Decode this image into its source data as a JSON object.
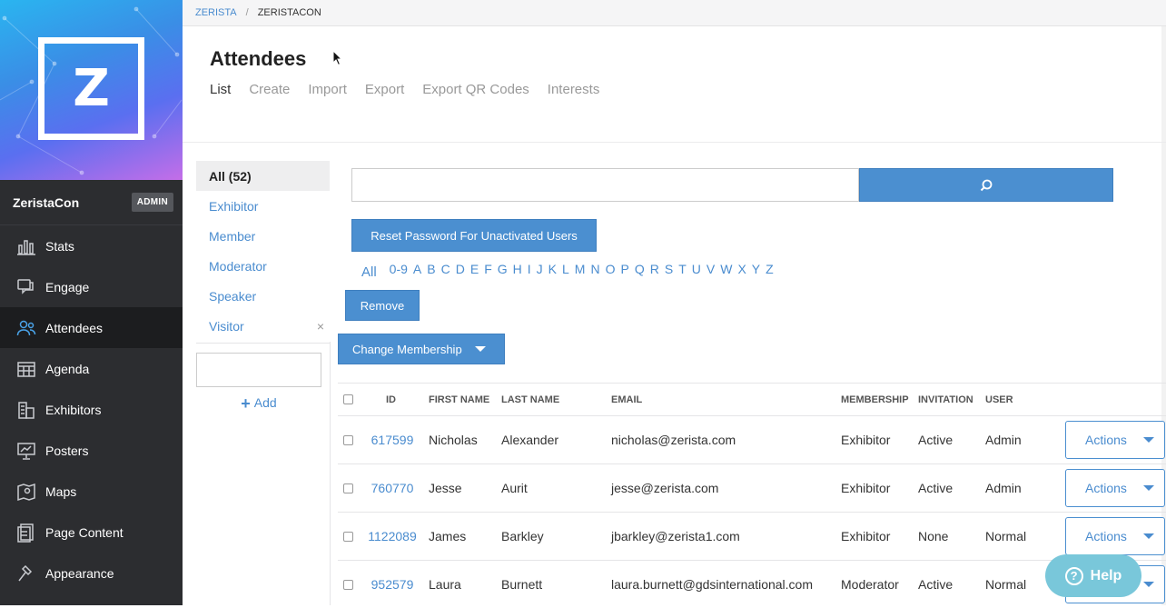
{
  "breadcrumb": {
    "root": "ZERISTA",
    "separator": "/",
    "current": "ZERISTACON"
  },
  "sidebar": {
    "logo_letter": "Z",
    "app_name": "ZeristaCon",
    "badge": "ADMIN",
    "items": [
      {
        "label": "Stats",
        "icon": "stats-icon"
      },
      {
        "label": "Engage",
        "icon": "chat-icon"
      },
      {
        "label": "Attendees",
        "icon": "people-icon",
        "active": true
      },
      {
        "label": "Agenda",
        "icon": "calendar-icon"
      },
      {
        "label": "Exhibitors",
        "icon": "building-icon"
      },
      {
        "label": "Posters",
        "icon": "presentation-icon"
      },
      {
        "label": "Maps",
        "icon": "map-icon"
      },
      {
        "label": "Page Content",
        "icon": "pages-icon"
      },
      {
        "label": "Appearance",
        "icon": "hammer-icon"
      }
    ]
  },
  "header": {
    "title": "Attendees",
    "tabs": [
      "List",
      "Create",
      "Import",
      "Export",
      "Export QR Codes",
      "Interests"
    ]
  },
  "filters": {
    "items": [
      "All (52)",
      "Exhibitor",
      "Member",
      "Moderator",
      "Speaker",
      "Visitor"
    ],
    "remove_symbol": "×",
    "add_label": "Add",
    "add_symbol": "+"
  },
  "search": {
    "placeholder": "",
    "value": ""
  },
  "actions": {
    "reset_label": "Reset Password For Unactivated Users",
    "remove_label": "Remove",
    "change_label": "Change Membership"
  },
  "alphabet": {
    "all": "All",
    "letters": [
      "0-9",
      "A",
      "B",
      "C",
      "D",
      "E",
      "F",
      "G",
      "H",
      "I",
      "J",
      "K",
      "L",
      "M",
      "N",
      "O",
      "P",
      "Q",
      "R",
      "S",
      "T",
      "U",
      "V",
      "W",
      "X",
      "Y",
      "Z"
    ]
  },
  "table": {
    "columns": [
      "ID",
      "FIRST NAME",
      "LAST NAME",
      "EMAIL",
      "MEMBERSHIP",
      "INVITATION",
      "USER"
    ],
    "action_label": "Actions",
    "rows": [
      {
        "id": "617599",
        "first": "Nicholas",
        "last": "Alexander",
        "email": "nicholas@zerista.com",
        "membership": "Exhibitor",
        "invitation": "Active",
        "user": "Admin"
      },
      {
        "id": "760770",
        "first": "Jesse",
        "last": "Aurit",
        "email": "jesse@zerista.com",
        "membership": "Exhibitor",
        "invitation": "Active",
        "user": "Admin"
      },
      {
        "id": "1122089",
        "first": "James",
        "last": "Barkley",
        "email": "jbarkley@zerista1.com",
        "membership": "Exhibitor",
        "invitation": "None",
        "user": "Normal"
      },
      {
        "id": "952579",
        "first": "Laura",
        "last": "Burnett",
        "email": "laura.burnett@gdsinternational.com",
        "membership": "Moderator",
        "invitation": "Active",
        "user": "Normal"
      }
    ]
  },
  "help": {
    "label": "Help",
    "symbol": "?"
  },
  "colors": {
    "accent": "#4b8fd0",
    "sidebar": "#2c2d30",
    "help": "#79c7da"
  }
}
